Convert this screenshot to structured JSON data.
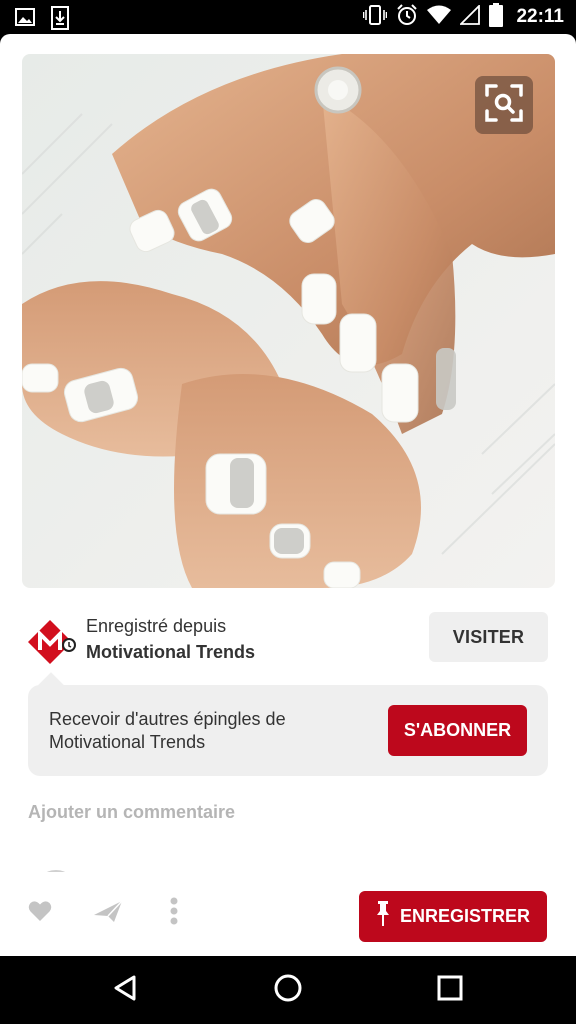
{
  "status_bar": {
    "time": "22:11",
    "left_icons": [
      "image-notification-icon",
      "download-notification-icon"
    ],
    "right_icons": [
      "vibrate-icon",
      "alarm-icon",
      "wifi-icon",
      "cellular-signal-icon",
      "battery-icon"
    ]
  },
  "pin": {
    "image_description": "nail-art-photo",
    "zoom_icon": "visual-search-icon"
  },
  "source": {
    "label": "Enregistré depuis",
    "name": "Motivational Trends",
    "visit_label": "VISITER"
  },
  "follow": {
    "text": "Recevoir d'autres épingles de Motivational Trends",
    "button_label": "S'ABONNER"
  },
  "comment": {
    "placeholder": "Ajouter un commentaire"
  },
  "actions": {
    "like_icon": "heart-icon",
    "send_icon": "send-icon",
    "more_icon": "more-vertical-icon",
    "save_label": "ENREGISTRER",
    "save_icon": "pin-icon"
  },
  "nav": {
    "back": "back-icon",
    "home": "home-icon",
    "recents": "recents-icon"
  },
  "colors": {
    "brand_red": "#bd081c",
    "muted_gray": "#efefef"
  }
}
